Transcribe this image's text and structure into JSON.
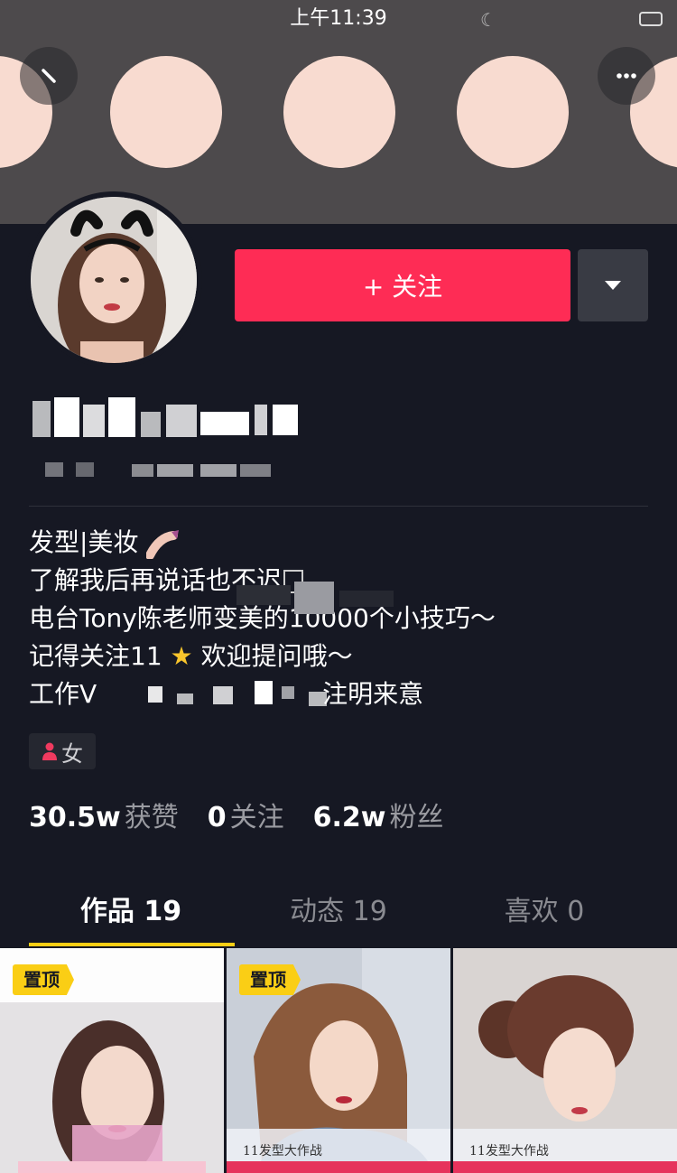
{
  "status_bar": {
    "time": "上午11:39"
  },
  "header": {
    "back_icon": "back-icon",
    "more_icon": "more-icon"
  },
  "profile": {
    "follow_label": "+ 关注",
    "dropdown_icon": "caret-down-icon"
  },
  "bio": {
    "lines": [
      "发型|美妆",
      "了解我后再说话也不迟",
      "电台Tony陈老师变美的10000个小技巧～",
      "记得关注11",
      "工作V",
      "注明来意"
    ],
    "line4_suffix": "欢迎提问哦～"
  },
  "gender": {
    "label": "女"
  },
  "stats": [
    {
      "value": "30.5w",
      "label": "获赞"
    },
    {
      "value": "0",
      "label": "关注"
    },
    {
      "value": "6.2w",
      "label": "粉丝"
    }
  ],
  "tabs": [
    {
      "label": "作品 19"
    },
    {
      "label": "动态 19"
    },
    {
      "label": "喜欢 0"
    }
  ],
  "thumbnails": [
    {
      "badge": "置顶"
    },
    {
      "badge": "置顶",
      "caption": "11发型大作战"
    },
    {
      "caption": "11发型大作战"
    }
  ],
  "colors": {
    "accent": "#fe2c55",
    "background": "#161823",
    "highlight": "#face15"
  }
}
